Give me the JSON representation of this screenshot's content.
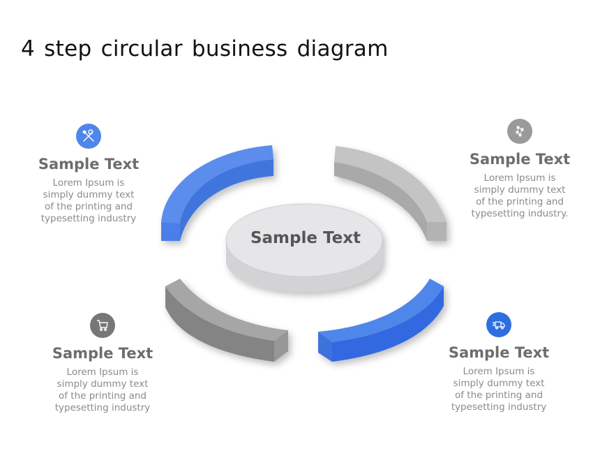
{
  "title": "4 step circular business diagram",
  "center": {
    "label": "Sample Text"
  },
  "colors": {
    "blue": "#4a7fe6",
    "blue_light": "#5b8ded",
    "gray_light": "#b9b9b9",
    "gray_dark": "#8e8e8e",
    "center_top": "#e6e6e8",
    "center_side": "#d3d3d5"
  },
  "steps": [
    {
      "position": "top-left",
      "icon": "tools-icon",
      "icon_color": "#4f86ea",
      "heading": "Sample Text",
      "lines": [
        "Lorem Ipsum is",
        "simply dummy text",
        "of the printing and",
        "typesetting industry"
      ]
    },
    {
      "position": "top-right",
      "icon": "network-icon",
      "icon_color": "#9a9a9a",
      "heading": "Sample Text",
      "lines": [
        "Lorem Ipsum is",
        "simply dummy text",
        "of the printing and",
        "typesetting industry."
      ]
    },
    {
      "position": "bottom-left",
      "icon": "cart-icon",
      "icon_color": "#777777",
      "heading": "Sample Text",
      "lines": [
        "Lorem Ipsum is",
        "simply dummy text",
        "of the printing and",
        "typesetting industry"
      ]
    },
    {
      "position": "bottom-right",
      "icon": "truck-icon",
      "icon_color": "#2e6fe0",
      "heading": "Sample Text",
      "lines": [
        "Lorem Ipsum is",
        "simply dummy text",
        "of the printing and",
        "typesetting industry"
      ]
    }
  ]
}
